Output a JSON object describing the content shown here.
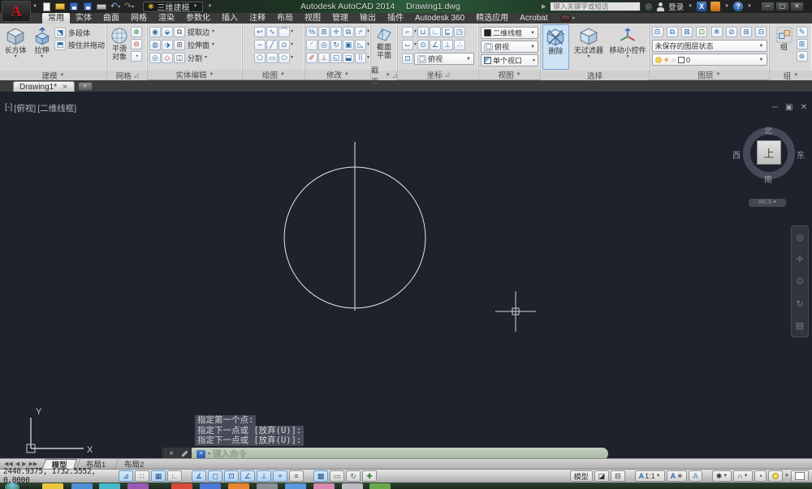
{
  "titlebar": {
    "workspace": "三维建模",
    "app_title": "Autodesk AutoCAD 2014",
    "doc_title": "Drawing1.dwg",
    "search_placeholder": "键入关键字或短语",
    "signin_label": "登录"
  },
  "ribbon_tabs": [
    "常用",
    "实体",
    "曲面",
    "网格",
    "渲染",
    "参数化",
    "插入",
    "注释",
    "布局",
    "视图",
    "管理",
    "输出",
    "插件",
    "Autodesk 360",
    "精选应用",
    "Acrobat"
  ],
  "panels": {
    "modeling": {
      "label": "建模",
      "btn_box": "长方体",
      "btn_extrude": "拉伸",
      "btn_polysolid": "多段体",
      "btn_presspull": "按住并拖动"
    },
    "mesh": {
      "label": "网格",
      "btn_smooth": "平滑\n对象"
    },
    "solid_edit": {
      "label": "实体编辑",
      "btn_extract": "提取边",
      "btn_extrude_face": "拉伸面",
      "btn_separate": "分割"
    },
    "draw": {
      "label": "绘图"
    },
    "modify": {
      "label": "修改"
    },
    "section": {
      "label": "截面",
      "btn_plane": "截面\n平面"
    },
    "coordinates": {
      "label": "坐标",
      "view_dropdown": "俯视"
    },
    "view": {
      "label": "视图",
      "visual_style": "二维线框",
      "named_view": "俯视",
      "viewport_cfg": "单个视口"
    },
    "selection": {
      "label": "选择",
      "btn_erase": "删除",
      "btn_nofilter": "无过滤器",
      "btn_gizmo": "移动小控件"
    },
    "layers": {
      "label": "图层",
      "layer_state": "未保存的图层状态",
      "current_layer": "0"
    },
    "group": {
      "label": "组",
      "btn_group": "组"
    }
  },
  "file_tab": {
    "name": "Drawing1*"
  },
  "canvas": {
    "vp_minus": "[-]",
    "vp_view": "[俯视]",
    "vp_style": "[二维线框]",
    "viewcube": {
      "north": "北",
      "south": "南",
      "west": "西",
      "east": "东",
      "top": "上",
      "wcs": "WCS"
    },
    "ucs": {
      "x": "X",
      "y": "Y"
    }
  },
  "command": {
    "prompt1": "指定第一个点:",
    "prompt2": "指定下一点或 [放弃(U)]:",
    "prompt3": "指定下一点或 [放弃(U)]:",
    "input_placeholder": "键入命令"
  },
  "layout_tabs": {
    "model": "模型",
    "layout1": "布局1",
    "layout2": "布局2"
  },
  "statusbar": {
    "coordinates": "2440.9375, 1732.5552,  0.0000",
    "model_btn": "模型",
    "annotation_scale": "1:1"
  }
}
